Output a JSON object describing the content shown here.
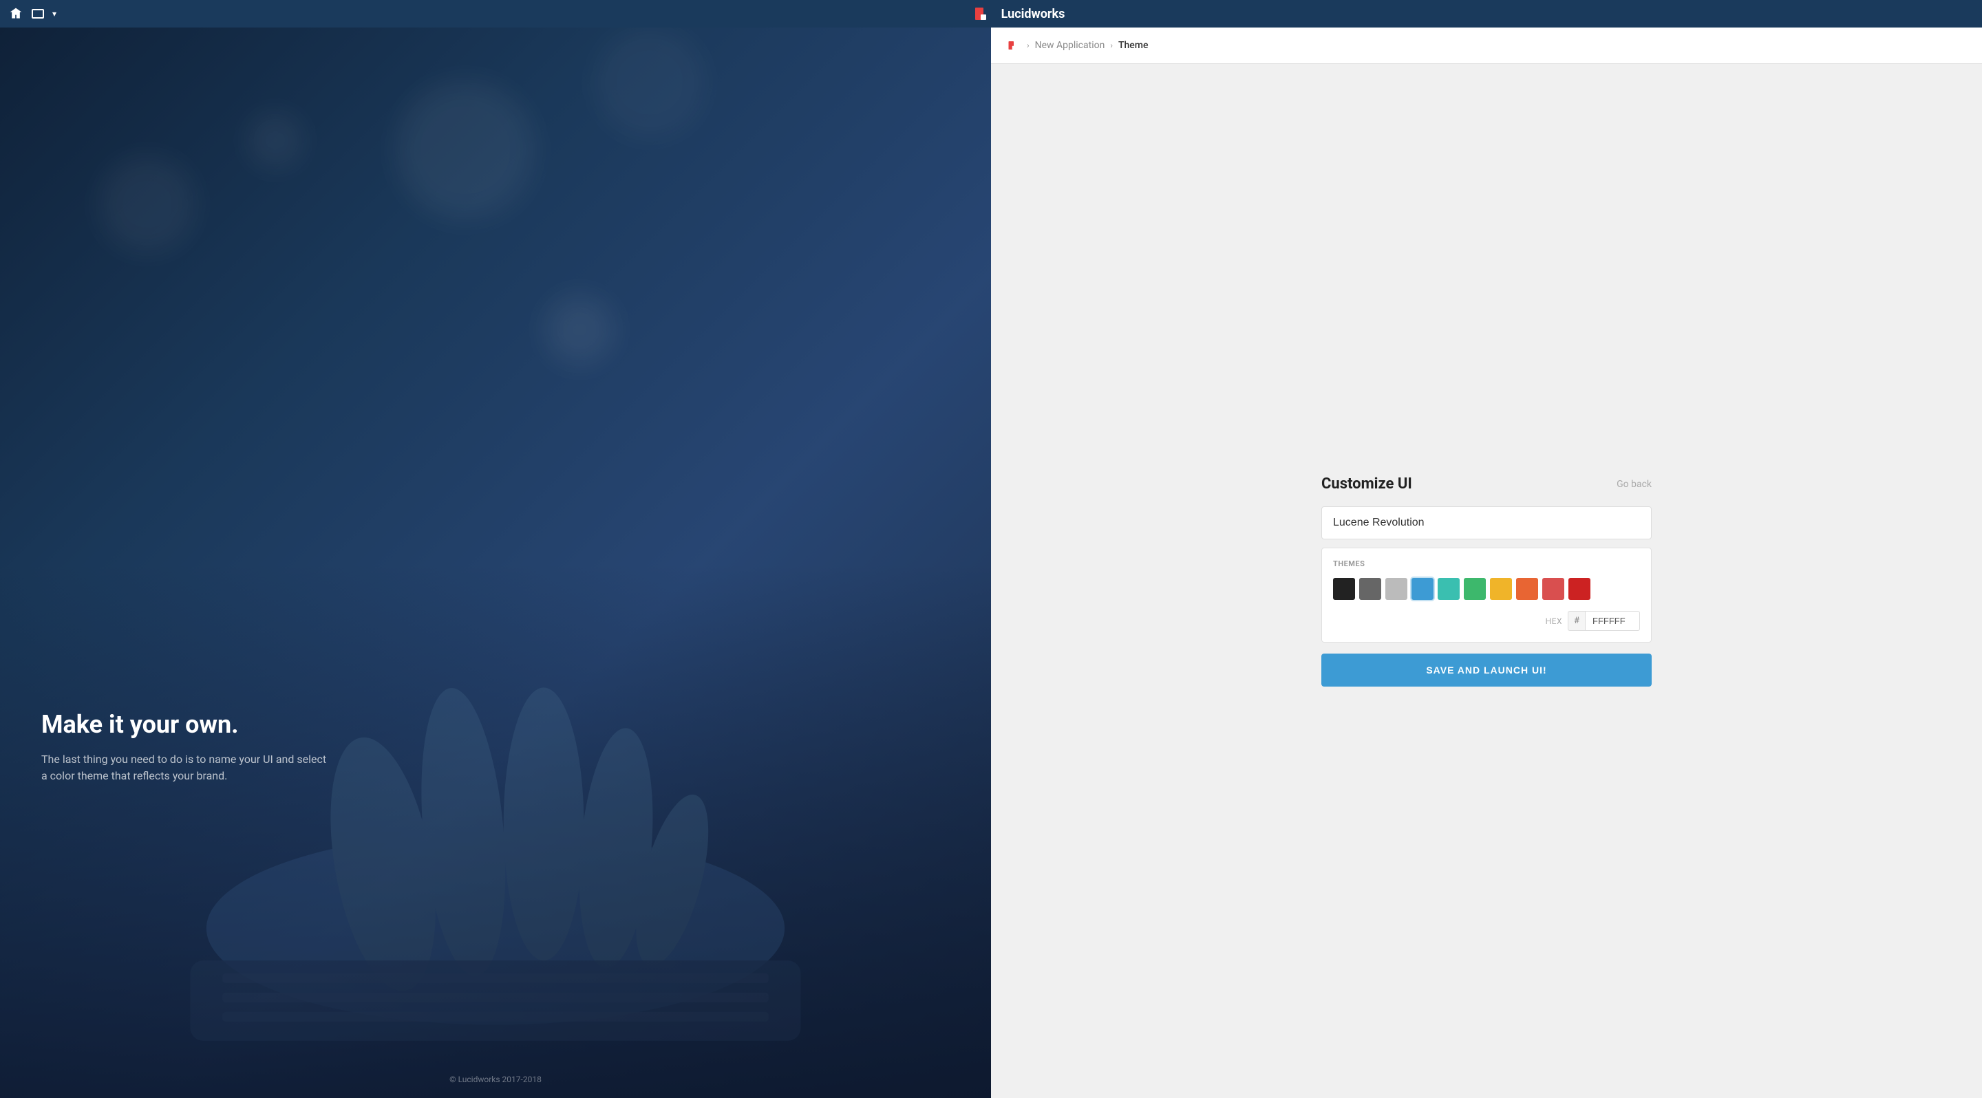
{
  "topbar": {
    "app_name": "Lucidworks",
    "dropdown_icon": "▾"
  },
  "breadcrumb": {
    "home_label": "home",
    "new_application": "New Application",
    "current": "Theme",
    "separator": "›"
  },
  "left_panel": {
    "title": "Make it your own.",
    "subtitle": "The last thing you need to do is to name your UI and select a color theme that reflects your brand.",
    "copyright": "© Lucidworks 2017-2018"
  },
  "form": {
    "title": "Customize UI",
    "go_back": "Go back",
    "name_placeholder": "Lucene Revolution",
    "themes_label": "THEMES",
    "hex_label": "HEX",
    "hex_hash": "#",
    "hex_value": "FFFFFF",
    "save_button": "SAVE AND LAUNCH UI!",
    "colors": [
      {
        "id": "black",
        "hex": "#222222",
        "selected": false
      },
      {
        "id": "dark-gray",
        "hex": "#666666",
        "selected": false
      },
      {
        "id": "light-gray",
        "hex": "#bbbbbb",
        "selected": false
      },
      {
        "id": "blue",
        "hex": "#3d9bd4",
        "selected": true
      },
      {
        "id": "teal",
        "hex": "#3abfb0",
        "selected": false
      },
      {
        "id": "green",
        "hex": "#3db86c",
        "selected": false
      },
      {
        "id": "yellow",
        "hex": "#f0b429",
        "selected": false
      },
      {
        "id": "orange",
        "hex": "#e86533",
        "selected": false
      },
      {
        "id": "light-red",
        "hex": "#d94f4f",
        "selected": false
      },
      {
        "id": "red",
        "hex": "#cc2222",
        "selected": false
      }
    ]
  }
}
